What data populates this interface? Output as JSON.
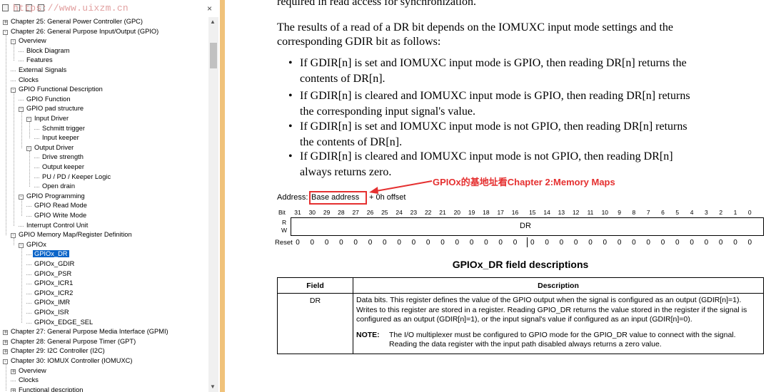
{
  "toolbar": {
    "watermark": "https://www.uixzm.cn",
    "close": "×"
  },
  "tree": [
    {
      "d": 0,
      "t": "Chapter 25: General Power Controller (GPC)",
      "e": "+"
    },
    {
      "d": 0,
      "t": "Chapter 26: General Purpose Input/Output (GPIO)",
      "e": "-"
    },
    {
      "d": 1,
      "t": "Overview",
      "e": "-"
    },
    {
      "d": 2,
      "t": "Block Diagram"
    },
    {
      "d": 2,
      "t": "Features"
    },
    {
      "d": 1,
      "t": "External Signals"
    },
    {
      "d": 1,
      "t": "Clocks"
    },
    {
      "d": 1,
      "t": "GPIO Functional Description",
      "e": "-"
    },
    {
      "d": 2,
      "t": "GPIO Function"
    },
    {
      "d": 2,
      "t": "GPIO pad structure",
      "e": "-"
    },
    {
      "d": 3,
      "t": "Input Driver",
      "e": "-"
    },
    {
      "d": 4,
      "t": "Schmitt trigger"
    },
    {
      "d": 4,
      "t": "Input keeper"
    },
    {
      "d": 3,
      "t": "Output Driver",
      "e": "-"
    },
    {
      "d": 4,
      "t": "Drive strength"
    },
    {
      "d": 4,
      "t": "Output keeper"
    },
    {
      "d": 4,
      "t": "PU / PD / Keeper Logic"
    },
    {
      "d": 4,
      "t": "Open drain"
    },
    {
      "d": 2,
      "t": "GPIO Programming",
      "e": "-"
    },
    {
      "d": 3,
      "t": "GPIO Read Mode"
    },
    {
      "d": 3,
      "t": "GPIO Write Mode"
    },
    {
      "d": 2,
      "t": "Interrupt Control Unit"
    },
    {
      "d": 1,
      "t": "GPIO Memory Map/Register Definition",
      "e": "-"
    },
    {
      "d": 2,
      "t": "GPIOx",
      "e": "-"
    },
    {
      "d": 3,
      "t": "GPIOx_DR",
      "sel": true
    },
    {
      "d": 3,
      "t": "GPIOx_GDIR"
    },
    {
      "d": 3,
      "t": "GPIOx_PSR"
    },
    {
      "d": 3,
      "t": "GPIOx_ICR1"
    },
    {
      "d": 3,
      "t": "GPIOx_ICR2"
    },
    {
      "d": 3,
      "t": "GPIOx_IMR"
    },
    {
      "d": 3,
      "t": "GPIOx_ISR"
    },
    {
      "d": 3,
      "t": "GPIOx_EDGE_SEL"
    },
    {
      "d": 0,
      "t": "Chapter 27: General Purpose Media Interface (GPMI)",
      "e": "+"
    },
    {
      "d": 0,
      "t": "Chapter 28: General Purpose Timer (GPT)",
      "e": "+"
    },
    {
      "d": 0,
      "t": "Chapter 29: I2C Controller (I2C)",
      "e": "+"
    },
    {
      "d": 0,
      "t": "Chapter 30: IOMUX Controller (IOMUXC)",
      "e": "-"
    },
    {
      "d": 1,
      "t": "Overview",
      "e": "+"
    },
    {
      "d": 1,
      "t": "Clocks"
    },
    {
      "d": 1,
      "t": "Functional description",
      "e": "+"
    }
  ],
  "doc": {
    "top_line": "required in read access for synchronization.",
    "para_l1": "The results of a read of a DR bit depends on the IOMUXC input mode settings and the",
    "para_l2": "corresponding GDIR bit as follows:",
    "bullets": [
      {
        "l1": "If GDIR[n] is set and IOMUXC input mode is GPIO, then reading DR[n] returns the",
        "l2": "contents of DR[n]."
      },
      {
        "l1": "If GDIR[n] is cleared and IOMUXC input mode is GPIO, then reading DR[n] returns",
        "l2": "the corresponding input signal's value."
      },
      {
        "l1": "If GDIR[n] is set and IOMUXC input mode is not GPIO, then reading DR[n] returns",
        "l2": "the contents of DR[n]."
      },
      {
        "l1": "If GDIR[n] is cleared and IOMUXC input mode is not GPIO, then reading DR[n]",
        "l2": "always returns zero."
      }
    ],
    "annotation": "GPIOx的基地址看Chapter 2:Memory Maps",
    "address_label": "Address:",
    "address_base": "Base address",
    "address_offset": "+ 0h offset",
    "bit_label": "Bit",
    "r_label": "R",
    "w_label": "W",
    "reset_label": "Reset",
    "field_name": "DR",
    "reset_value": "0",
    "table_title": "GPIOx_DR field descriptions",
    "col_field": "Field",
    "col_desc": "Description",
    "row_field": "DR",
    "row_desc": "Data bits. This register defines the value of the GPIO output when the signal is configured as an output (GDIR[n]=1). Writes to this register are stored in a register. Reading GPIO_DR returns the value stored in the register if the signal is configured as an output (GDIR[n]=1), or the input signal's value if configured as an input (GDIR[n]=0).",
    "note_label": "NOTE:",
    "note_text": "The I/O multiplexer must be configured to GPIO mode for the GPIO_DR value to connect with the signal. Reading the data register with the input path disabled always returns a zero value."
  },
  "colors": {
    "selection": "#0a64c8",
    "annotation": "#e53030",
    "divider": "#f0c27a"
  }
}
